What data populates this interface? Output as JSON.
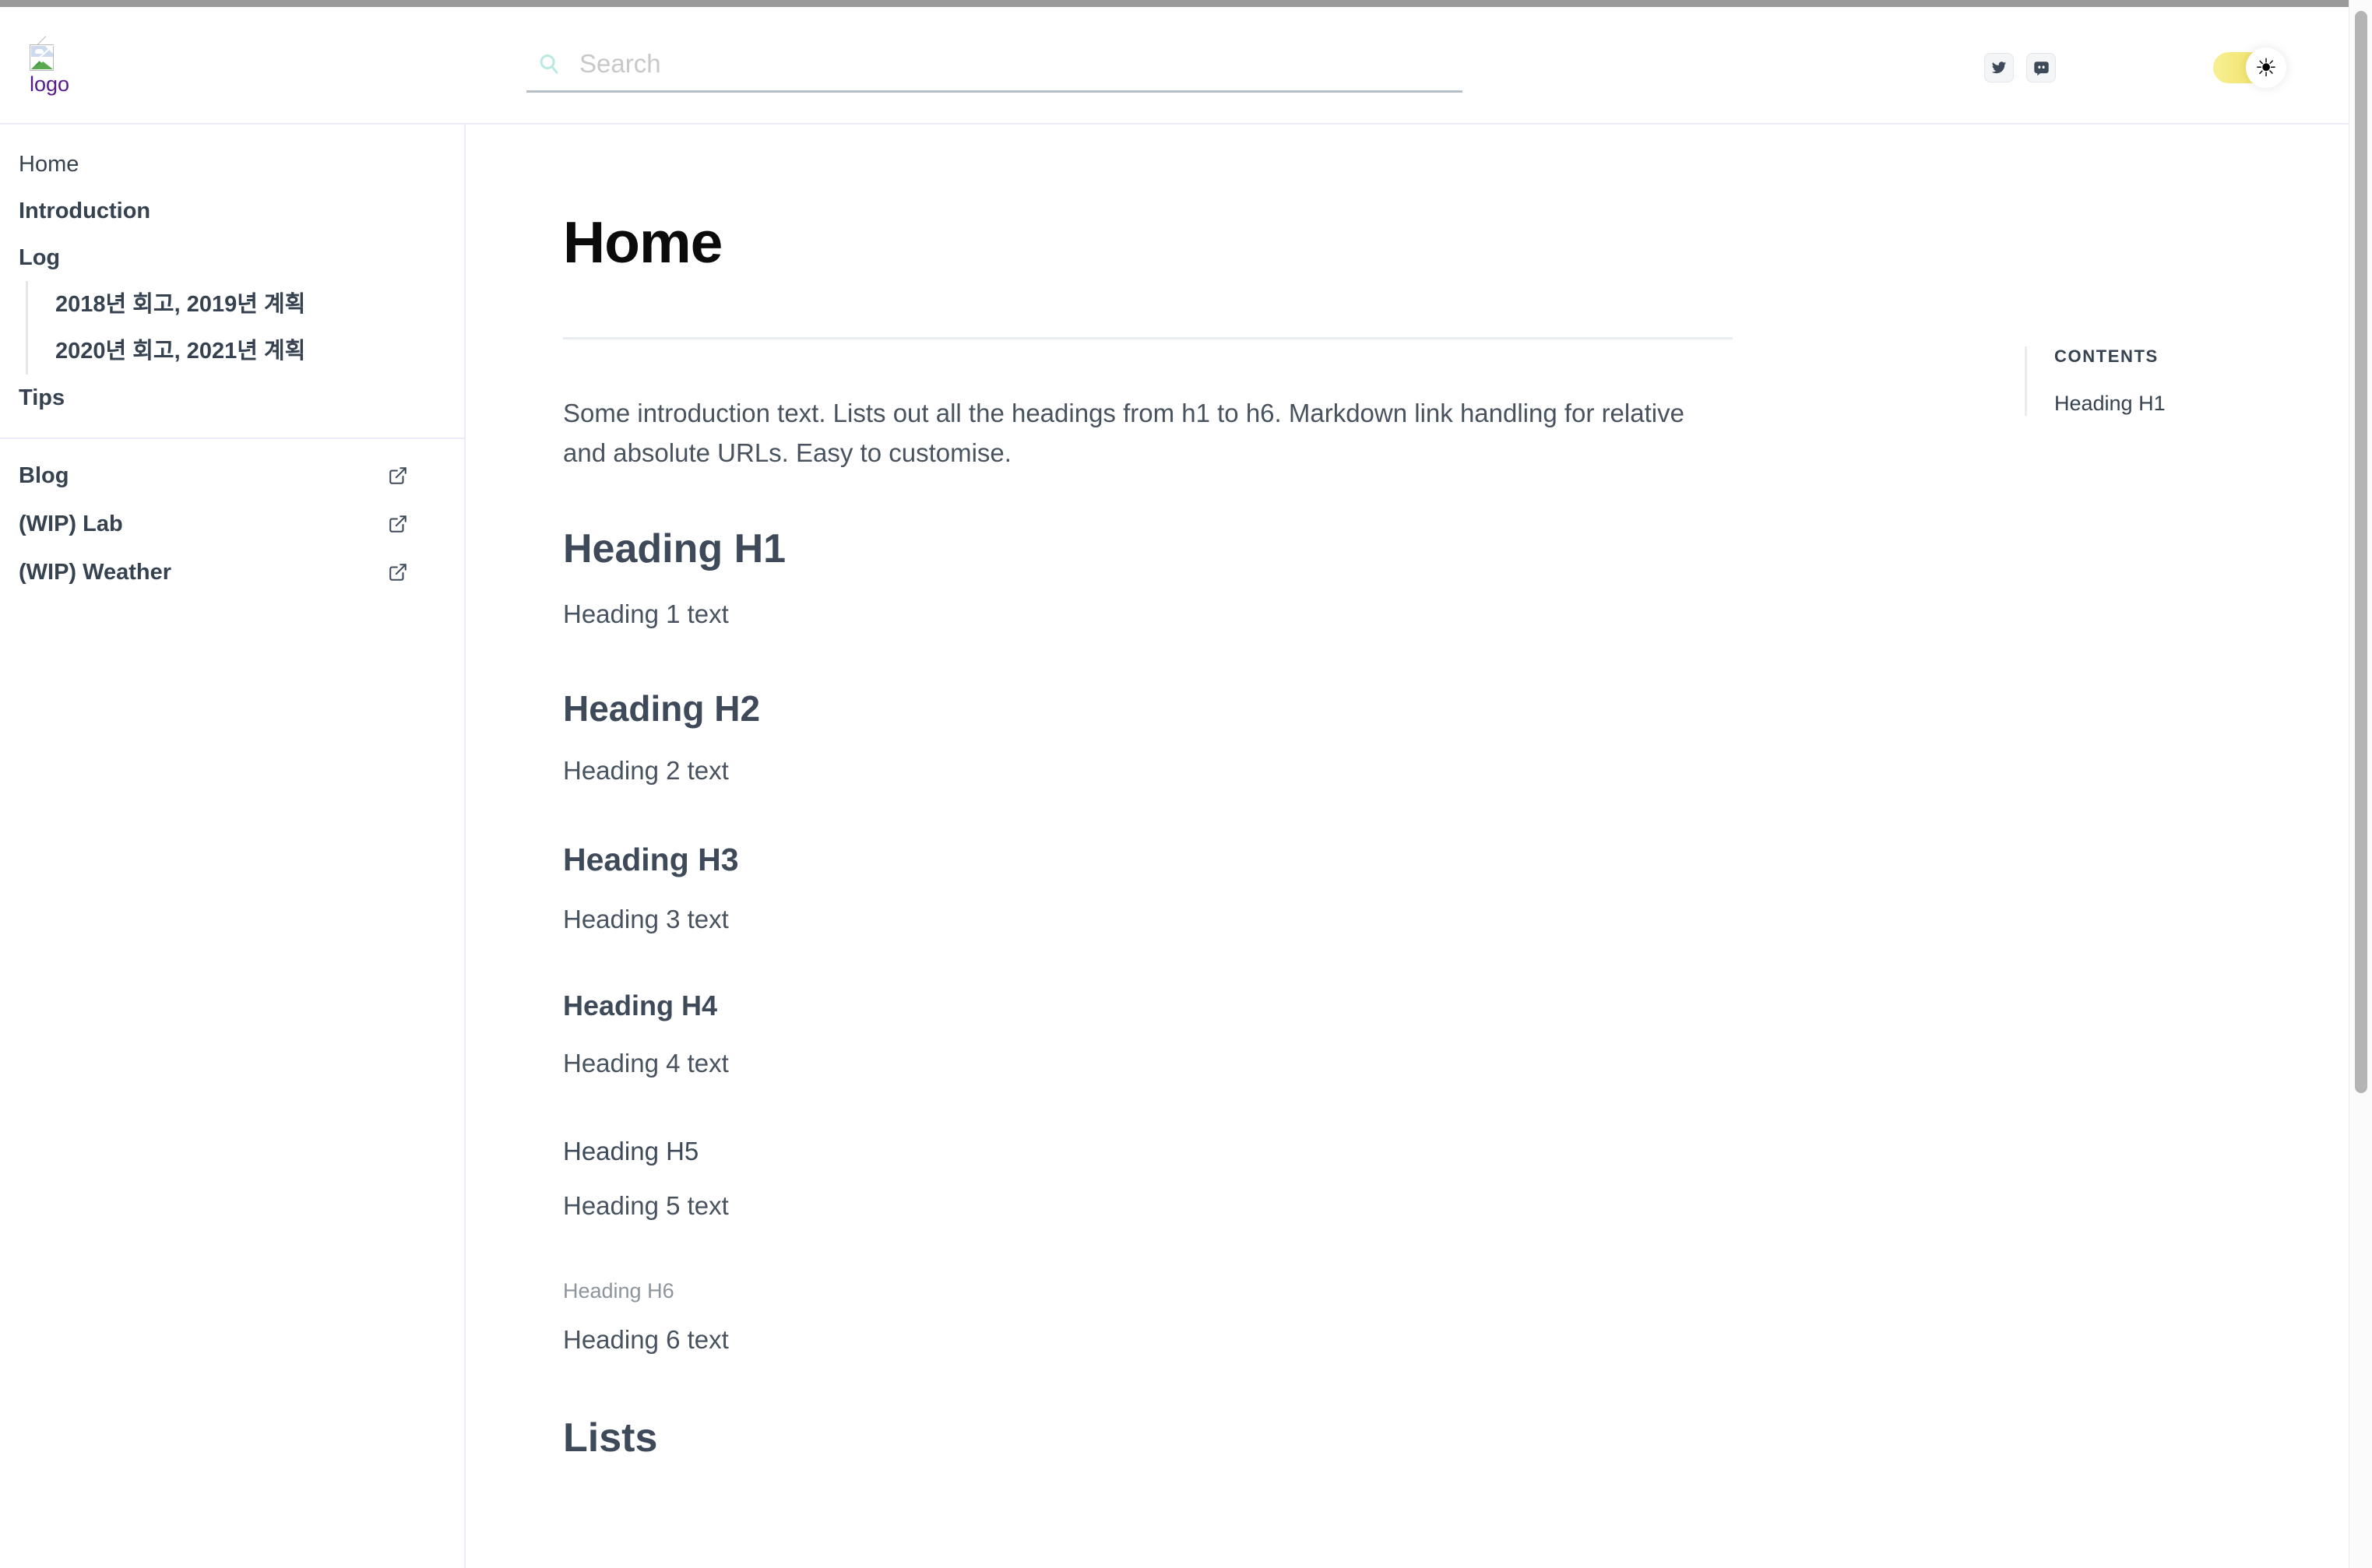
{
  "browser": {
    "scrollbar_name": "page-scrollbar"
  },
  "header": {
    "logo_alt": "logo",
    "search": {
      "value": "",
      "placeholder": "Search",
      "icon": "search-icon"
    },
    "social": [
      {
        "name": "twitter-icon",
        "label": "Twitter"
      },
      {
        "name": "discord-icon",
        "label": "Discord"
      }
    ],
    "theme_toggle": {
      "name": "theme-toggle",
      "state": "light",
      "icon": "sun-icon",
      "glyph": "☀",
      "track_color": "#f0e05c",
      "knob_color": "#ffffff"
    }
  },
  "sidebar": {
    "items": [
      {
        "label": "Home",
        "active": true
      },
      {
        "label": "Introduction",
        "active": false
      },
      {
        "label": "Log",
        "active": false
      }
    ],
    "sub_items": [
      {
        "label": "2018년 회고, 2019년 계획"
      },
      {
        "label": "2020년 회고, 2021년 계획"
      }
    ],
    "items_after": [
      {
        "label": "Tips"
      }
    ],
    "external": [
      {
        "label": "Blog",
        "icon": "external-link-icon"
      },
      {
        "label": "(WIP) Lab",
        "icon": "external-link-icon"
      },
      {
        "label": "(WIP) Weather",
        "icon": "external-link-icon"
      }
    ]
  },
  "main": {
    "title": "Home",
    "lede": "Some introduction text. Lists out all the headings from h1 to h6. Markdown link handling for relative and absolute URLs. Easy to customise.",
    "sections": [
      {
        "heading": "Heading H1",
        "text": "Heading 1 text"
      },
      {
        "heading": "Heading H2",
        "text": "Heading 2 text"
      },
      {
        "heading": "Heading H3",
        "text": "Heading 3 text"
      },
      {
        "heading": "Heading H4",
        "text": "Heading 4 text"
      },
      {
        "heading": "Heading H5",
        "text": "Heading 5 text"
      },
      {
        "heading": "Heading H6",
        "text": "Heading 6 text"
      }
    ],
    "lists_heading": "Lists"
  },
  "toc": {
    "title": "CONTENTS",
    "links": [
      {
        "label": "Heading H1"
      }
    ]
  },
  "colors": {
    "heading": "#3e4a59",
    "body": "#48535f",
    "muted": "#8d949c",
    "divider": "#eeeaf8",
    "accent_toggle": "#f0e05c",
    "search_icon": "#b8eae3",
    "logo_alt_text": "#551a8b"
  }
}
